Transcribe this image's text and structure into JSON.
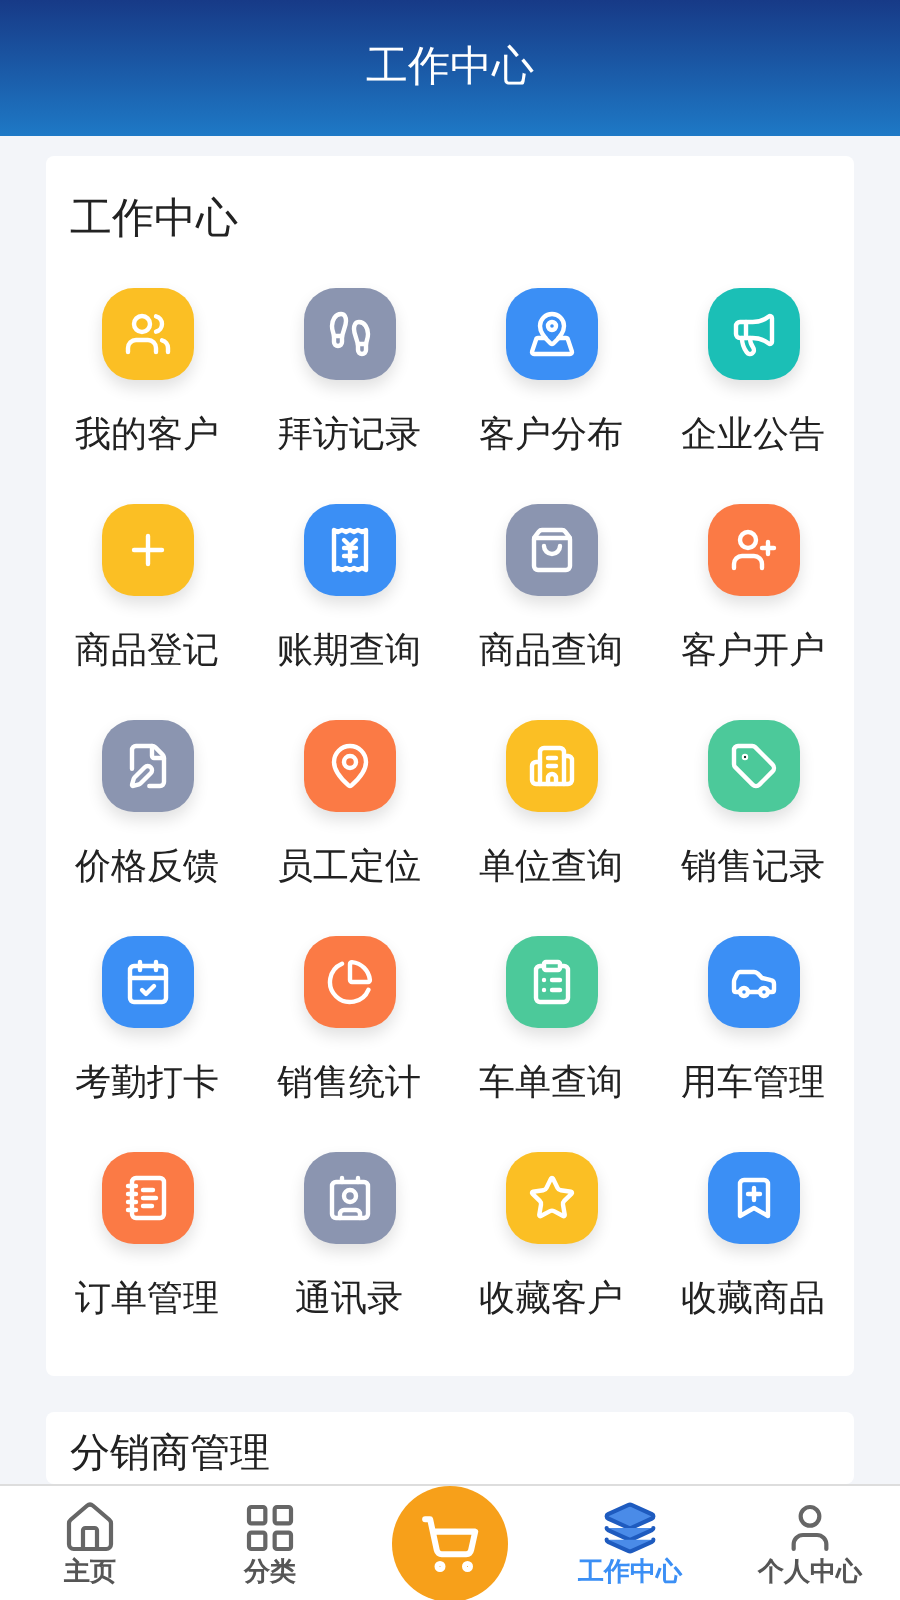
{
  "header": {
    "title": "工作中心"
  },
  "work_center": {
    "title": "工作中心",
    "items": [
      {
        "label": "我的客户",
        "color": "#fbbf24"
      },
      {
        "label": "拜访记录",
        "color": "#8b95b0"
      },
      {
        "label": "客户分布",
        "color": "#3b8ff5"
      },
      {
        "label": "企业公告",
        "color": "#1bbfb6"
      },
      {
        "label": "商品登记",
        "color": "#fbbf24"
      },
      {
        "label": "账期查询",
        "color": "#3b8ff5"
      },
      {
        "label": "商品查询",
        "color": "#8b95b0"
      },
      {
        "label": "客户开户",
        "color": "#fb7a45"
      },
      {
        "label": "价格反馈",
        "color": "#8b95b0"
      },
      {
        "label": "员工定位",
        "color": "#fb7a45"
      },
      {
        "label": "单位查询",
        "color": "#fbbf24"
      },
      {
        "label": "销售记录",
        "color": "#4cc99a"
      },
      {
        "label": "考勤打卡",
        "color": "#3b8ff5"
      },
      {
        "label": "销售统计",
        "color": "#fb7a45"
      },
      {
        "label": "车单查询",
        "color": "#4cc99a"
      },
      {
        "label": "用车管理",
        "color": "#3b8ff5"
      },
      {
        "label": "订单管理",
        "color": "#fb7a45"
      },
      {
        "label": "通讯录",
        "color": "#8b95b0"
      },
      {
        "label": "收藏客户",
        "color": "#fbbf24"
      },
      {
        "label": "收藏商品",
        "color": "#3b8ff5"
      }
    ]
  },
  "distributor_section": {
    "title": "分销商管理"
  },
  "tab_bar": [
    {
      "kind": "tab",
      "label": "主页",
      "selected": false
    },
    {
      "kind": "tab",
      "label": "分类",
      "selected": false
    },
    {
      "kind": "cart",
      "selected": false
    },
    {
      "kind": "tab",
      "label": "工作中心",
      "selected": true
    },
    {
      "kind": "tab",
      "label": "个人中心",
      "selected": false
    }
  ]
}
